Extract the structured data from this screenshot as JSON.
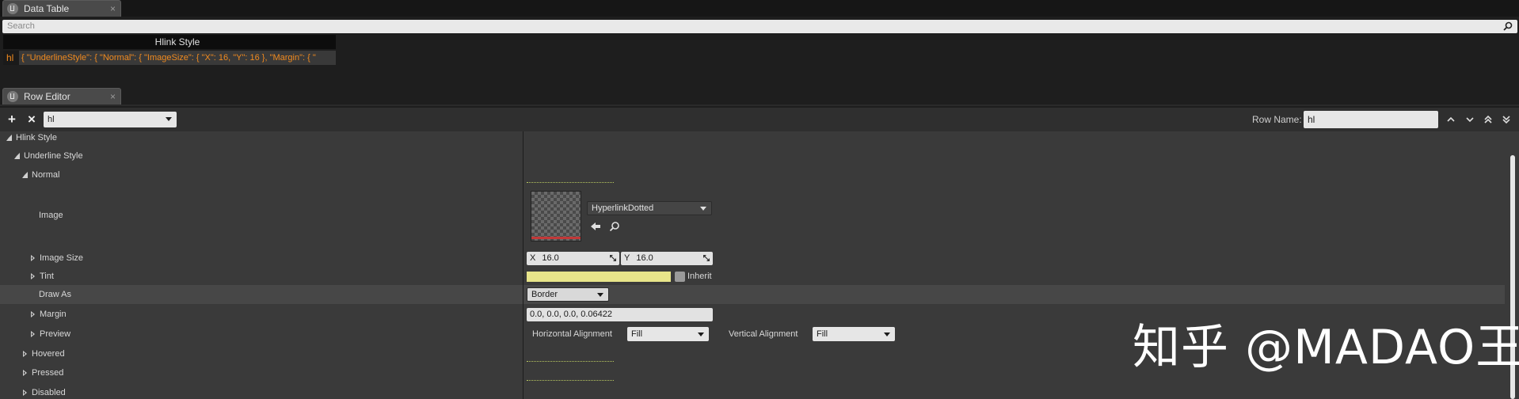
{
  "data_table_tab": {
    "title": "Data Table",
    "close": "×"
  },
  "search": {
    "placeholder": "Search"
  },
  "table": {
    "column_header": "Hlink Style",
    "rows": [
      {
        "name": "hl",
        "value": "{ \"UnderlineStyle\": { \"Normal\": { \"ImageSize\": { \"X\": 16, \"Y\": 16 }, \"Margin\": { \""
      }
    ]
  },
  "row_editor_tab": {
    "title": "Row Editor",
    "close": "×"
  },
  "toolbar": {
    "add": "+",
    "remove": "×",
    "row_select": "hl",
    "row_name_label": "Row Name:",
    "row_name_value": "hl"
  },
  "tree": {
    "hlink_style": "Hlink Style",
    "underline_style": "Underline Style",
    "normal": "Normal",
    "image": "Image",
    "image_size": "Image Size",
    "tint": "Tint",
    "draw_as": "Draw As",
    "margin": "Margin",
    "preview": "Preview",
    "hovered": "Hovered",
    "pressed": "Pressed",
    "disabled": "Disabled"
  },
  "values": {
    "image_asset": "HyperlinkDotted",
    "size_x_axis": "X",
    "size_x": "16.0",
    "size_y_axis": "Y",
    "size_y": "16.0",
    "tint_color": "#e8e58a",
    "inherit_label": "Inherit",
    "draw_as": "Border",
    "margin": "0.0, 0.0, 0.0, 0.06422",
    "h_align_label": "Horizontal Alignment",
    "h_align": "Fill",
    "v_align_label": "Vertical Alignment",
    "v_align": "Fill"
  },
  "watermark": "知乎 @MADAO王",
  "colors": {
    "accent_orange": "#f08a1f",
    "panel": "#3a3a3a",
    "highlight_row": "#474747"
  }
}
